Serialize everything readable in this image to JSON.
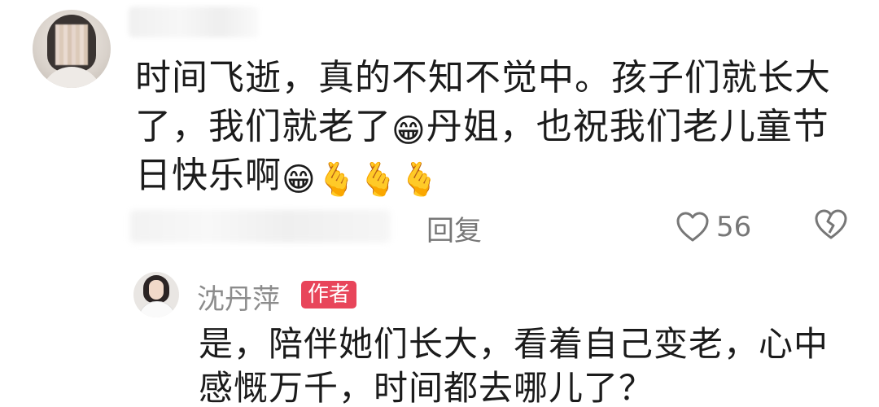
{
  "comment": {
    "text_part1": "时间飞逝，真的不知不觉中。孩子们就长大了，我们就老了",
    "emoji_grin_1": "😁",
    "text_part2": "丹姐，也祝我们老儿童节日快乐啊",
    "emoji_grin_2": "😁",
    "emoji_heart_hand_1": "🫰",
    "emoji_heart_hand_2": "🫰",
    "emoji_heart_hand_3": "🫰",
    "reply_label": "回复",
    "like_count": "56"
  },
  "reply": {
    "author_name": "沈丹萍",
    "author_badge": "作者",
    "text": "是，陪伴她们长大，看着自己变老，心中感慨万千，时间都去哪儿了？"
  },
  "icons": {
    "like": "heart-outline-icon",
    "dislike": "broken-heart-icon"
  },
  "colors": {
    "badge": "#e8455a",
    "meta_text": "#777777"
  }
}
